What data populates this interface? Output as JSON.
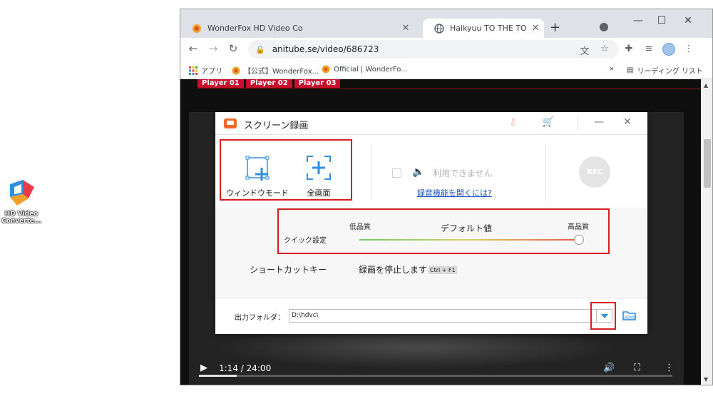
{
  "desktop": {
    "icon_label": "HD Video Converte..."
  },
  "browser": {
    "tabs": [
      {
        "title": "WonderFox HD Video Co",
        "active": false
      },
      {
        "title": "Haikyuu TO THE TOP Ep",
        "active": true
      }
    ],
    "url": "anitube.se/video/686723",
    "bookmarks": [
      "アプリ",
      "【公式】WonderFox...",
      "Official | WonderFo..."
    ],
    "reading_list": "リーディング リスト",
    "more_bookmarks": "»"
  },
  "page": {
    "player_tabs": [
      "Player 01",
      "Player 02",
      "Player 03"
    ],
    "time": "1:14 / 24:00",
    "progress": 0.08
  },
  "dialog": {
    "title": "スクリーン録画",
    "modes": [
      {
        "label": "ウィンドウモード",
        "icon": "window-capture-icon"
      },
      {
        "label": "全画面",
        "icon": "fullscreen-capture-icon"
      }
    ],
    "audio_label": "利用できません",
    "audio_link": "録音機能を開くには?",
    "rec_label": "REC",
    "quick": {
      "label": "クイック設定",
      "low": "低品質",
      "default": "デフォルト値",
      "high": "高品質",
      "level": 1.0
    },
    "shortcut": {
      "label": "ショートカットキー",
      "action": "録画を停止します",
      "key": "Ctrl + F1"
    },
    "output": {
      "label": "出力フォルダ：",
      "path": "D:\\hdvc\\"
    }
  },
  "colors": {
    "highlight_box": "#d62020",
    "accent_blue": "#2f8fe0",
    "app_orange": "#ee6a2a",
    "player_red": "#c8102e"
  }
}
